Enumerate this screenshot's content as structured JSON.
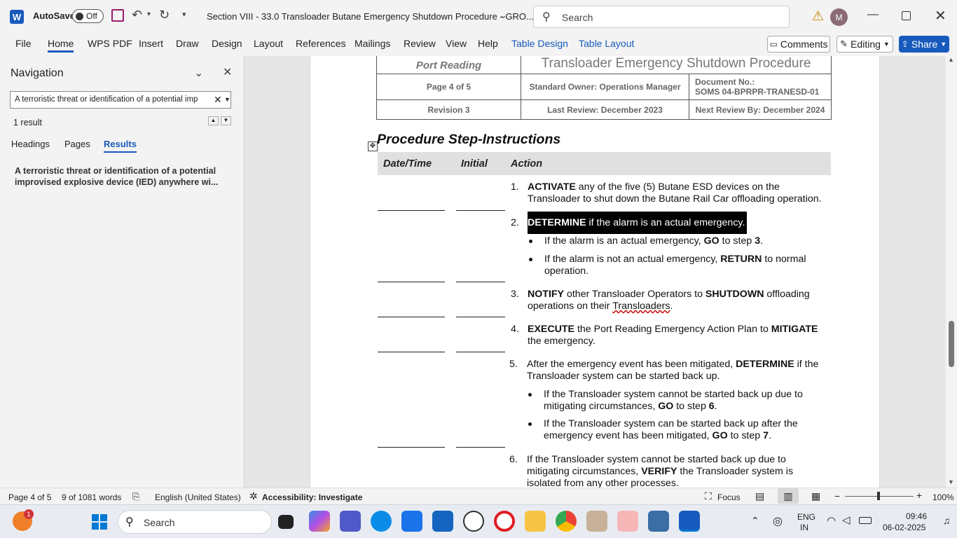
{
  "titlebar": {
    "app_letter": "W",
    "autosave_label": "AutoSave",
    "autosave_state": "Off",
    "doc_title": "Section VIII - 33.0 Transloader Butane Emergency Shutdown Procedure - GRO...",
    "search_placeholder": "Search",
    "avatar_letter": "M"
  },
  "menu": {
    "items": [
      "File",
      "Home",
      "WPS PDF",
      "Insert",
      "Draw",
      "Design",
      "Layout",
      "References",
      "Mailings",
      "Review",
      "View",
      "Help",
      "Table Design",
      "Table Layout"
    ],
    "comments_label": "Comments",
    "editing_label": "Editing",
    "share_label": "Share"
  },
  "nav": {
    "title": "Navigation",
    "search_value": "A terroristic threat or identification of a potential imp",
    "result_count": "1 result",
    "tabs": [
      "Headings",
      "Pages",
      "Results"
    ],
    "result_text": "A terroristic threat or identification of a potential improvised explosive device (IED) anywhere wi..."
  },
  "doc": {
    "header": {
      "company": "Port Reading",
      "title": "Transloader Emergency Shutdown Procedure",
      "page": "Page 4 of 5",
      "owner": "Standard Owner: Operations Manager",
      "docno_label": "Document No.:",
      "docno": "SOMS 04-BPRPR-TRANESD-01",
      "revision": "Revision 3",
      "last_review": "Last Review: December 2023",
      "next_review": "Next Review By: December 2024"
    },
    "section_title": "Procedure Step-Instructions",
    "columns": [
      "Date/Time",
      "Initial",
      "Action"
    ],
    "steps": [
      {
        "n": "1.",
        "parts": [
          [
            "b",
            "ACTIVATE"
          ],
          [
            "t",
            " any of the five (5) Butane ESD devices on the Transloader to shut down the Butane Rail Car offloading operation."
          ]
        ]
      },
      {
        "n": "2.",
        "parts": [
          [
            "b",
            "DETERMINE"
          ],
          [
            "t",
            " if the alarm is an actual emergency."
          ]
        ]
      },
      {
        "n": "3.",
        "parts": [
          [
            "b",
            "NOTIFY"
          ],
          [
            "t",
            " other Transloader Operators to "
          ],
          [
            "b",
            "SHUTDOWN"
          ],
          [
            "t",
            " offloading operations on their "
          ],
          [
            "u",
            "Transloaders"
          ],
          [
            "t",
            "."
          ]
        ]
      },
      {
        "n": "4.",
        "parts": [
          [
            "b",
            "EXECUTE"
          ],
          [
            "t",
            " the Port Reading Emergency Action Plan to "
          ],
          [
            "b",
            "MITIGATE"
          ],
          [
            "t",
            " the emergency."
          ]
        ]
      },
      {
        "n": "5.",
        "parts": [
          [
            "t",
            "After the emergency event has been mitigated, "
          ],
          [
            "b",
            "DETERMINE"
          ],
          [
            "t",
            " if the Transloader system can be started back up."
          ]
        ]
      },
      {
        "n": "6.",
        "parts": [
          [
            "t",
            "If the Transloader system cannot be started back up due to mitigating circumstances, "
          ],
          [
            "b",
            "VERIFY"
          ],
          [
            "t",
            " the Transloader system is isolated from any other processes."
          ]
        ]
      }
    ],
    "bullets2": [
      [
        [
          "t",
          "If the alarm is an actual emergency, "
        ],
        [
          "b",
          "GO"
        ],
        [
          "t",
          " to step "
        ],
        [
          "b",
          "3"
        ],
        [
          "t",
          "."
        ]
      ],
      [
        [
          "t",
          "If the alarm is not an actual emergency, "
        ],
        [
          "b",
          "RETURN"
        ],
        [
          "t",
          " to normal operation."
        ]
      ]
    ],
    "bullets5": [
      [
        [
          "t",
          "If the Transloader system cannot be started back up due to mitigating circumstances, "
        ],
        [
          "b",
          "GO"
        ],
        [
          "t",
          " to step "
        ],
        [
          "b",
          "6"
        ],
        [
          "t",
          "."
        ]
      ],
      [
        [
          "t",
          "If the Transloader system can be started back up after the emergency event has been mitigated, "
        ],
        [
          "b",
          "GO"
        ],
        [
          "t",
          " to step "
        ],
        [
          "b",
          "7"
        ],
        [
          "t",
          "."
        ]
      ]
    ]
  },
  "status": {
    "page": "Page 4 of 5",
    "words": "9 of 1081 words",
    "language": "English (United States)",
    "accessibility": "Accessibility: Investigate",
    "focus": "Focus",
    "zoom": "100%"
  },
  "taskbar": {
    "search_placeholder": "Search",
    "badge": "1",
    "lang": "ENG",
    "lang2": "IN",
    "time": "09:46",
    "date": "06-02-2025"
  },
  "colors": {
    "accent": "#185abd",
    "word_blue": "#185abd"
  }
}
